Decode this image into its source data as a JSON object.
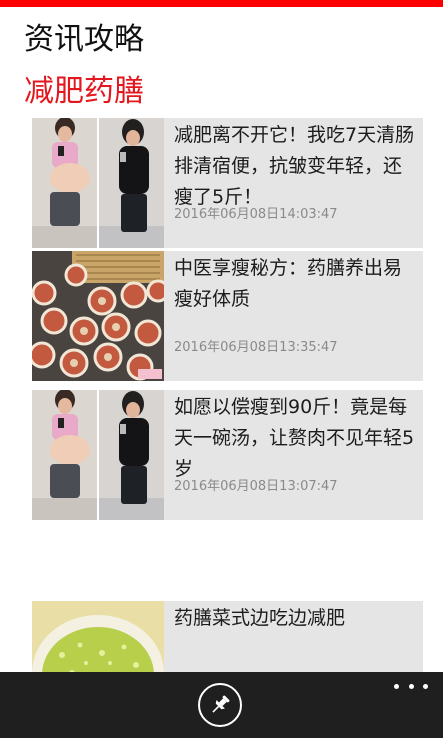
{
  "header": {
    "app_title": "资讯攻略",
    "section_title": "减肥药膳",
    "accent_color": "#ff0000",
    "section_color": "#e3171d"
  },
  "articles": [
    {
      "title": "减肥离不开它！我吃7天清肠排清宿便，抗皱变年轻，还瘦了5斤！",
      "date": "2016年06月08日14:03:47",
      "thumbnail": "before-after-photo"
    },
    {
      "title": "中医享瘦秘方：药膳养出易瘦好体质",
      "date": "2016年06月08日13:35:47",
      "thumbnail": "food-rolls-photo"
    },
    {
      "title": "如愿以偿瘦到90斤！竟是每天一碗汤，让赘肉不见年轻5岁",
      "date": "2016年06月08日13:07:47",
      "thumbnail": "before-after-photo"
    },
    {
      "title": "药膳菜式边吃边减肥",
      "date": "",
      "thumbnail": "soup-bowl-photo"
    }
  ],
  "app_bar": {
    "pin_icon": "pin-icon",
    "more_icon": "more-dots-icon",
    "background": "#1f1f1f"
  }
}
